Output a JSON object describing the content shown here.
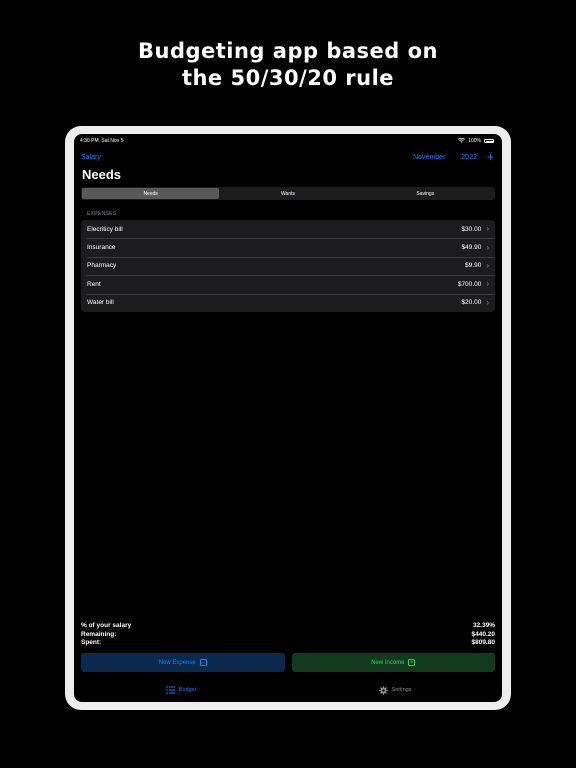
{
  "promo": {
    "line1": "Budgeting app based on",
    "line2": "the 50/30/20 rule"
  },
  "statusbar": {
    "time": "4:30 PM",
    "date": "Sat Nov 5",
    "battery": "100%",
    "battery_level": 1.0
  },
  "navbar": {
    "salary_label": "Salary",
    "month": "November",
    "year": "2022",
    "add_icon": "plus-icon"
  },
  "page": {
    "title": "Needs"
  },
  "segments": [
    {
      "label": "Needs",
      "selected": true
    },
    {
      "label": "Wants",
      "selected": false
    },
    {
      "label": "Savings",
      "selected": false
    }
  ],
  "expenses": {
    "section_label": "EXPENSES",
    "items": [
      {
        "name": "Elecriticy bill",
        "amount": "$30.00"
      },
      {
        "name": "Insurance",
        "amount": "$49.90"
      },
      {
        "name": "Pharmacy",
        "amount": "$9.90"
      },
      {
        "name": "Rent",
        "amount": "$700.00"
      },
      {
        "name": "Water bill",
        "amount": "$20.00"
      }
    ]
  },
  "summary": {
    "percent_label": "% of your salary",
    "percent_value": "32.39%",
    "remaining_label": "Remaining:",
    "remaining_value": "$440.20",
    "spent_label": "Spent:",
    "spent_value": "$809.80"
  },
  "actions": {
    "new_expense": "New Expense",
    "new_income": "New Income"
  },
  "tabbar": {
    "budget": "Budget",
    "settings": "Settings"
  },
  "colors": {
    "accent": "#0a84ff",
    "income": "#30d158",
    "background": "#000000",
    "card": "#1c1c1e"
  }
}
